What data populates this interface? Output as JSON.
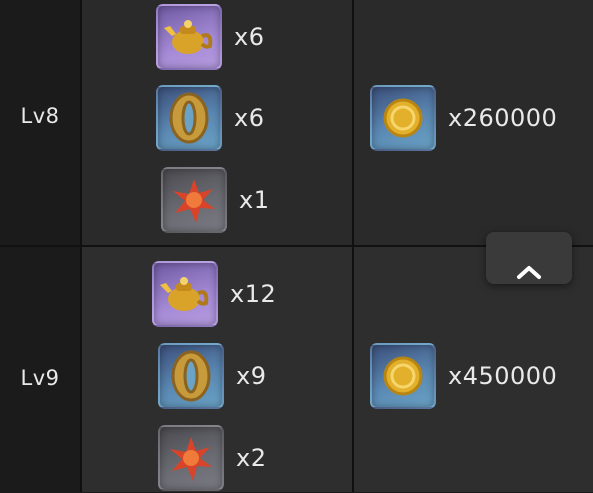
{
  "rows": [
    {
      "level": "Lv8",
      "materials": [
        {
          "icon": "gold-teapot-icon",
          "qty": "x6"
        },
        {
          "icon": "bronze-guard-icon",
          "qty": "x6"
        },
        {
          "icon": "red-crystal-icon",
          "qty": "x1"
        }
      ],
      "gold": {
        "icon": "gold-coin-icon",
        "qty": "x260000"
      }
    },
    {
      "level": "Lv9",
      "materials": [
        {
          "icon": "gold-teapot-icon",
          "qty": "x12"
        },
        {
          "icon": "bronze-guard-icon",
          "qty": "x9"
        },
        {
          "icon": "red-crystal-icon",
          "qty": "x2"
        }
      ],
      "gold": {
        "icon": "gold-coin-icon",
        "qty": "x450000"
      }
    }
  ],
  "scroll_top": {
    "icon": "chevron-up-icon"
  }
}
